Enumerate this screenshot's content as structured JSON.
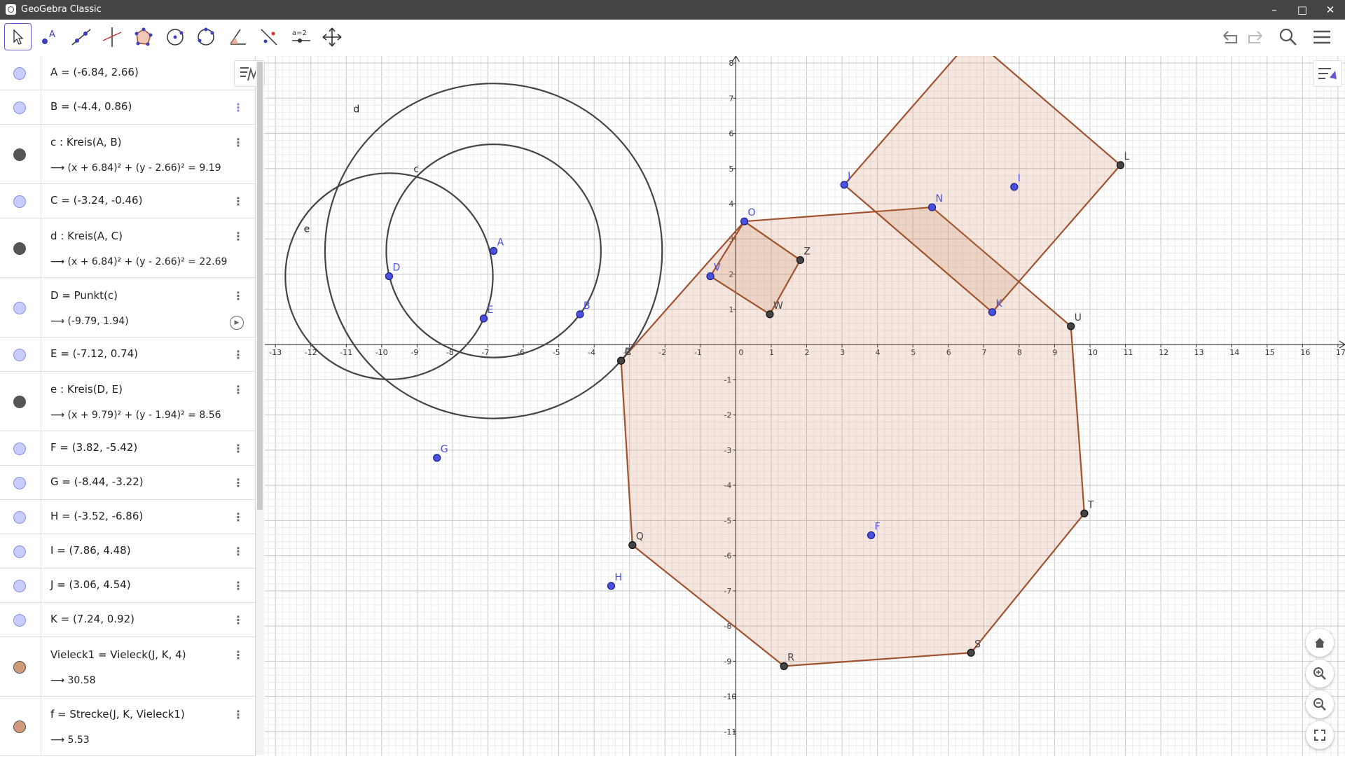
{
  "window": {
    "title": "GeoGebra Classic",
    "controls": [
      "minimize-icon",
      "maximize-icon",
      "close-icon"
    ]
  },
  "toolbar": {
    "tools": [
      "move-tool",
      "point-tool",
      "line-tool",
      "perpendicular-line-tool",
      "polygon-tool",
      "circle-tool",
      "circle-three-points-tool",
      "angle-tool",
      "reflect-tool",
      "slider-tool",
      "move-graphics-tool"
    ],
    "slider_label": "a=2",
    "right": [
      "undo-icon",
      "redo-icon",
      "search-icon",
      "menu-icon"
    ]
  },
  "colors": {
    "point": "#4a50e0",
    "polygon": "#a0522d",
    "circle": "#444444",
    "marble_point": "#c8ccff",
    "marble_circle": "#555555",
    "marble_polygon": "#d19a7a"
  },
  "algebra": {
    "items": [
      {
        "def": "A = (-6.84, 2.66)",
        "type": "point"
      },
      {
        "def": "B = (-4.4, 0.86)",
        "type": "point"
      },
      {
        "def": "c : Kreis(A, B)",
        "val": "⟶ (x + 6.84)² + (y - 2.66)² = 9.19",
        "type": "circle"
      },
      {
        "def": "C = (-3.24, -0.46)",
        "type": "point"
      },
      {
        "def": "d : Kreis(A, C)",
        "val": "⟶ (x + 6.84)² + (y - 2.66)² = 22.69",
        "type": "circle"
      },
      {
        "def": "D = Punkt(c)",
        "val": "⟶ (-9.79, 1.94)",
        "type": "point"
      },
      {
        "def": "E = (-7.12, 0.74)",
        "type": "point"
      },
      {
        "def": "e : Kreis(D, E)",
        "val": "⟶ (x + 9.79)² + (y - 1.94)² = 8.56",
        "type": "circle"
      },
      {
        "def": "F = (3.82, -5.42)",
        "type": "point"
      },
      {
        "def": "G = (-8.44, -3.22)",
        "type": "point"
      },
      {
        "def": "H = (-3.52, -6.86)",
        "type": "point"
      },
      {
        "def": "I = (7.86, 4.48)",
        "type": "point"
      },
      {
        "def": "J = (3.06, 4.54)",
        "type": "point"
      },
      {
        "def": "K = (7.24, 0.92)",
        "type": "point"
      },
      {
        "def": "Vieleck1 = Vieleck(J, K, 4)",
        "val": "⟶ 30.58",
        "type": "polygon"
      },
      {
        "def": "f = Strecke(J, K, Vieleck1)",
        "val": "⟶ 5.53",
        "type": "polygon"
      }
    ]
  },
  "graphics": {
    "x_range": [
      -13.3,
      17.2
    ],
    "y_range": [
      -11.7,
      8.2
    ],
    "x_ticks": [
      "-13",
      "-12",
      "-11",
      "-10",
      "-9",
      "-8",
      "-7",
      "-6",
      "-5",
      "-4",
      "-3",
      "-2",
      "-1",
      "0",
      "1",
      "2",
      "3",
      "4",
      "5",
      "6",
      "7",
      "8",
      "9",
      "10",
      "11",
      "12",
      "13",
      "14",
      "15",
      "16",
      "17"
    ],
    "y_ticks": [
      "-11",
      "-10",
      "-9",
      "-8",
      "-7",
      "-6",
      "-5",
      "-4",
      "-3",
      "-2",
      "-1",
      "1",
      "2",
      "3",
      "4",
      "5",
      "6",
      "7",
      "8"
    ],
    "points": [
      {
        "label": "A",
        "x": -6.84,
        "y": 2.66,
        "kind": "free"
      },
      {
        "label": "B",
        "x": -4.4,
        "y": 0.86,
        "kind": "free"
      },
      {
        "label": "C",
        "x": -3.24,
        "y": -0.46,
        "kind": "dep"
      },
      {
        "label": "D",
        "x": -9.79,
        "y": 1.94,
        "kind": "free"
      },
      {
        "label": "E",
        "x": -7.12,
        "y": 0.74,
        "kind": "free"
      },
      {
        "label": "F",
        "x": 3.82,
        "y": -5.42,
        "kind": "free"
      },
      {
        "label": "G",
        "x": -8.44,
        "y": -3.22,
        "kind": "free"
      },
      {
        "label": "H",
        "x": -3.52,
        "y": -6.86,
        "kind": "free"
      },
      {
        "label": "I",
        "x": 7.86,
        "y": 4.48,
        "kind": "free"
      },
      {
        "label": "J",
        "x": 3.06,
        "y": 4.54,
        "kind": "free"
      },
      {
        "label": "K",
        "x": 7.24,
        "y": 0.92,
        "kind": "free"
      },
      {
        "label": "L",
        "x": 10.86,
        "y": 5.1,
        "kind": "dep"
      },
      {
        "label": "N",
        "x": 5.54,
        "y": 3.9,
        "kind": "free"
      },
      {
        "label": "O",
        "x": 0.24,
        "y": 3.5,
        "kind": "free"
      },
      {
        "label": "V",
        "x": -0.72,
        "y": 1.94,
        "kind": "free"
      },
      {
        "label": "W",
        "x": 0.96,
        "y": 0.86,
        "kind": "dep"
      },
      {
        "label": "Z",
        "x": 1.82,
        "y": 2.4,
        "kind": "dep"
      },
      {
        "label": "Q",
        "x": -2.92,
        "y": -5.7,
        "kind": "dep"
      },
      {
        "label": "R",
        "x": 1.36,
        "y": -9.14,
        "kind": "dep"
      },
      {
        "label": "S",
        "x": 6.64,
        "y": -8.76,
        "kind": "dep"
      },
      {
        "label": "T",
        "x": 9.84,
        "y": -4.8,
        "kind": "dep"
      },
      {
        "label": "U",
        "x": 9.46,
        "y": 0.52,
        "kind": "dep"
      },
      {
        "label": "P",
        "x": -3.24,
        "y": -0.46,
        "kind": "dep",
        "hidden_label": true
      }
    ],
    "circles": [
      {
        "label": "c",
        "cx": -6.84,
        "cy": 2.66,
        "r": 3.03,
        "label_pos": [
          -9.1,
          4.9
        ]
      },
      {
        "label": "d",
        "cx": -6.84,
        "cy": 2.66,
        "r": 4.76,
        "label_pos": [
          -10.8,
          6.6
        ]
      },
      {
        "label": "e",
        "cx": -9.79,
        "cy": 1.94,
        "r": 2.93,
        "label_pos": [
          -12.2,
          3.2
        ]
      }
    ],
    "polygons": [
      {
        "name": "big",
        "vertices": [
          [
            -3.24,
            -0.46
          ],
          [
            0.24,
            3.5
          ],
          [
            5.54,
            3.9
          ],
          [
            9.46,
            0.52
          ],
          [
            9.84,
            -4.8
          ],
          [
            6.64,
            -8.76
          ],
          [
            1.36,
            -9.14
          ],
          [
            -2.92,
            -5.7
          ]
        ]
      },
      {
        "name": "square",
        "vertices": [
          [
            3.06,
            4.54
          ],
          [
            7.24,
            0.92
          ],
          [
            10.86,
            5.1
          ],
          [
            6.68,
            8.72
          ]
        ]
      },
      {
        "name": "small",
        "vertices": [
          [
            -0.72,
            1.94
          ],
          [
            0.24,
            3.5
          ],
          [
            1.82,
            2.4
          ],
          [
            0.96,
            0.86
          ]
        ]
      }
    ]
  }
}
